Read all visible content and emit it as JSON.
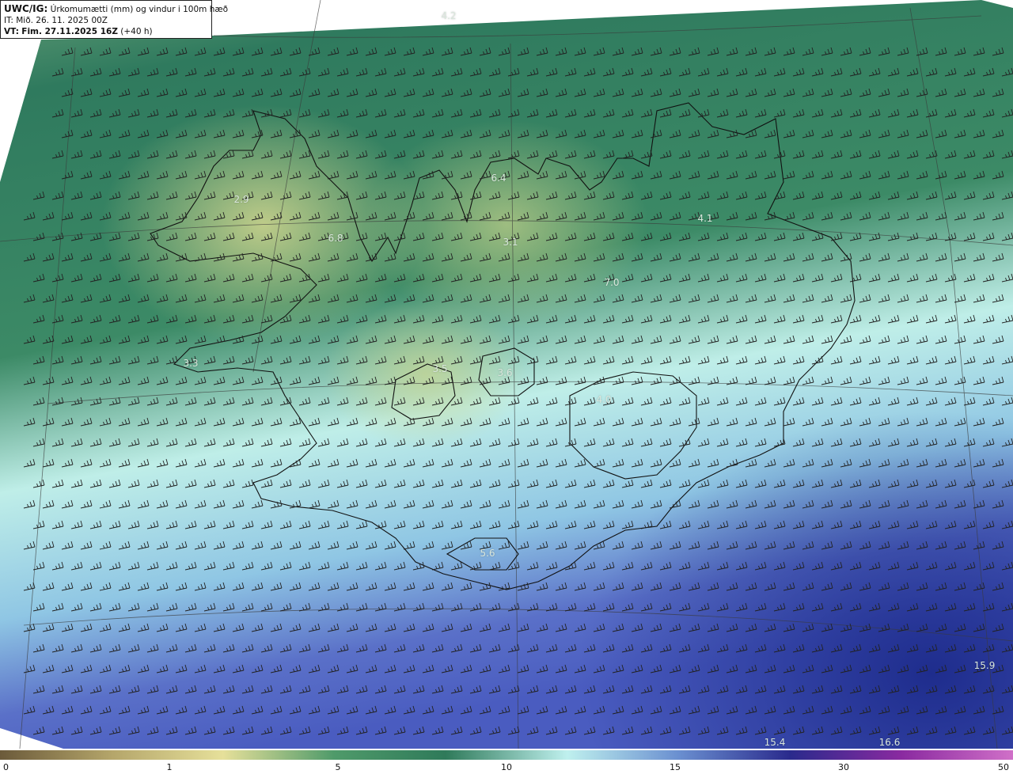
{
  "title": {
    "model": "UWC/IG:",
    "description": "Úrkomumætti (mm) og vindur i 100m hæð",
    "init_time": "IT: Mið. 26. 11. 2025 00Z",
    "valid_prefix": "VT:",
    "valid_time": "Fim. 27.11.2025 16Z",
    "lead": "(+40 h)"
  },
  "legend": {
    "ticks": [
      "0",
      "1",
      "5",
      "10",
      "15",
      "30",
      "50"
    ],
    "colors": [
      "#6b5a3a",
      "#b4a56a",
      "#e6e09a",
      "#4f9a6a",
      "#2f7a5a",
      "#bff0ee",
      "#6a8fd0",
      "#2a2a8c",
      "#8a2aa0",
      "#d070c8"
    ]
  },
  "map_labels": [
    {
      "text": "4.2"
    },
    {
      "text": "2.9"
    },
    {
      "text": "6.8"
    },
    {
      "text": "6.4"
    },
    {
      "text": "3.1"
    },
    {
      "text": "4.1"
    },
    {
      "text": "7.0"
    },
    {
      "text": "3.3"
    },
    {
      "text": "3.5"
    },
    {
      "text": "3.6"
    },
    {
      "text": "4.0"
    },
    {
      "text": "5.6"
    },
    {
      "text": "15.9"
    },
    {
      "text": "15.4"
    },
    {
      "text": "16.6"
    }
  ]
}
